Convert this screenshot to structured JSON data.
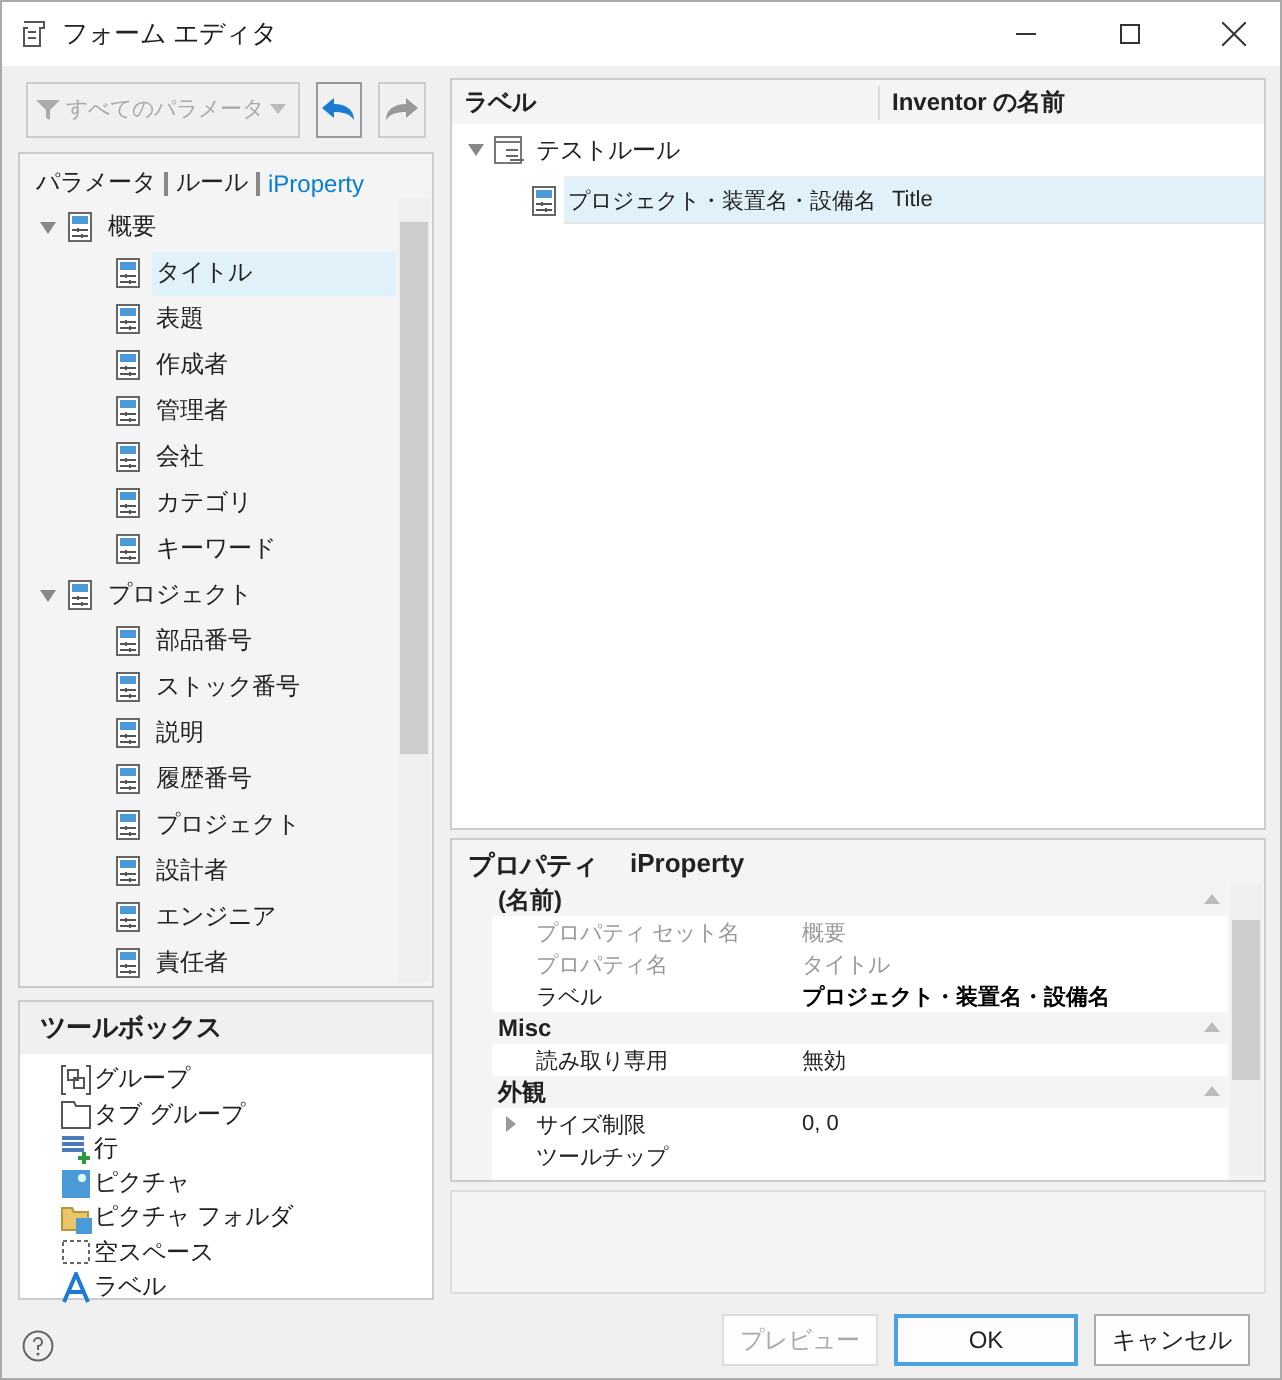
{
  "window": {
    "title": "フォーム エディタ"
  },
  "filter": {
    "label": "すべてのパラメータ",
    "disabled": true
  },
  "source_tabs": [
    {
      "label": "パラメータ",
      "selected": false
    },
    {
      "label": "ルール",
      "selected": false
    },
    {
      "label": "iProperty",
      "selected": true
    }
  ],
  "tree": [
    {
      "label": "概要",
      "expanded": true,
      "selected": false,
      "children": [
        {
          "label": "タイトル",
          "selected": true
        },
        {
          "label": "表題",
          "selected": false
        },
        {
          "label": "作成者",
          "selected": false
        },
        {
          "label": "管理者",
          "selected": false
        },
        {
          "label": "会社",
          "selected": false
        },
        {
          "label": "カテゴリ",
          "selected": false
        },
        {
          "label": "キーワード",
          "selected": false
        }
      ]
    },
    {
      "label": "プロジェクト",
      "expanded": true,
      "selected": false,
      "children": [
        {
          "label": "部品番号",
          "selected": false
        },
        {
          "label": "ストック番号",
          "selected": false
        },
        {
          "label": "説明",
          "selected": false
        },
        {
          "label": "履歴番号",
          "selected": false
        },
        {
          "label": "プロジェクト",
          "selected": false
        },
        {
          "label": "設計者",
          "selected": false
        },
        {
          "label": "エンジニア",
          "selected": false
        },
        {
          "label": "責任者",
          "selected": false
        }
      ]
    }
  ],
  "toolbox": {
    "title": "ツールボックス",
    "items": [
      {
        "kind": "group",
        "label": "グループ"
      },
      {
        "kind": "tabgroup",
        "label": "タブ グループ"
      },
      {
        "kind": "row",
        "label": "行"
      },
      {
        "kind": "picture",
        "label": "ピクチャ"
      },
      {
        "kind": "picturefolder",
        "label": "ピクチャ フォルダ"
      },
      {
        "kind": "space",
        "label": "空スペース"
      },
      {
        "kind": "label",
        "label": "ラベル"
      }
    ]
  },
  "form_table": {
    "columns": [
      "ラベル",
      "Inventor の名前"
    ],
    "root": {
      "label": "テストルール",
      "expanded": true
    },
    "rows": [
      {
        "label": "プロジェクト・装置名・設備名",
        "name": "Title",
        "selected": true
      }
    ]
  },
  "properties": {
    "title": "プロパティ",
    "subtitle": "iProperty",
    "categories": [
      {
        "label": "(名前)",
        "expanded": true,
        "rows": [
          {
            "name": "プロパティ セット名",
            "value": "概要",
            "disabled": true,
            "modified": false
          },
          {
            "name": "プロパティ名",
            "value": "タイトル",
            "disabled": true,
            "modified": false
          },
          {
            "name": "ラベル",
            "value": "プロジェクト・装置名・設備名",
            "disabled": false,
            "modified": true
          }
        ]
      },
      {
        "label": "Misc",
        "expanded": true,
        "rows": [
          {
            "name": "読み取り専用",
            "value": "無効",
            "disabled": false,
            "modified": false
          }
        ]
      },
      {
        "label": "外観",
        "expanded": true,
        "rows": [
          {
            "name": "サイズ制限",
            "value": "0, 0",
            "disabled": false,
            "modified": false,
            "expandable": true
          },
          {
            "name": "ツールチップ",
            "disabled": false,
            "modified": false
          }
        ]
      }
    ]
  },
  "buttons": [
    {
      "label": "プレビュー",
      "disabled": true,
      "default": false
    },
    {
      "label": "OK",
      "disabled": false,
      "default": true
    },
    {
      "label": "キャンセル",
      "disabled": false,
      "default": false
    }
  ]
}
